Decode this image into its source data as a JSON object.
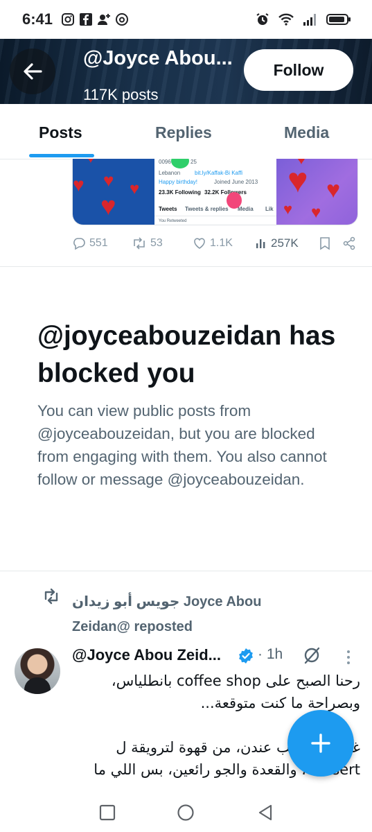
{
  "status_bar": {
    "time": "6:41",
    "left_icons": [
      "instagram-icon",
      "facebook-icon",
      "person-add-icon",
      "threads-icon"
    ],
    "right_icons": [
      "alarm-icon",
      "wifi-icon",
      "signal-icon",
      "battery-icon"
    ]
  },
  "header": {
    "display_name": "@Joyce Abou...",
    "post_count": "117K posts",
    "follow_label": "Follow"
  },
  "tabs": [
    {
      "label": "Posts",
      "active": true
    },
    {
      "label": "Replies",
      "active": false
    },
    {
      "label": "Media",
      "active": false
    }
  ],
  "media_card": {
    "phone": "0096",
    "phone_end": "25",
    "location": "Lebanon",
    "link": "bit.ly/Kaffak-Bi Kaffi",
    "birthday": "Happy birthday!",
    "joined": "Joined June 2013",
    "following": "23.3K Following",
    "followers": "32.2K Followers",
    "tab_tweets": "Tweets",
    "tab_replies": "Tweets & replies",
    "tab_media": "Media",
    "tab_likes": "Lik",
    "retweeted": "You Retweeted"
  },
  "actions": {
    "replies": "551",
    "reposts": "53",
    "likes": "1.1K",
    "views": "257K"
  },
  "blocked": {
    "title": "@joyceabouzeidan has blocked you",
    "description": "You can view public posts from @joyceabouzeidan, but you are blocked from engaging with them. You also cannot follow or message @joyceabouzeidan."
  },
  "repost": {
    "text": "جويس أبو زيدان Joyce Abou Zeidan@ reposted"
  },
  "tweet": {
    "author": "@Joyce Abou Zeid...",
    "time": "· 1h",
    "line1": "رحنا الصبح على coffee shop بانطلياس، وبصراحة ما كنت متوقعة...",
    "line2": "غير شي طيب عندن، من قهوة لترويقة ل dessert، والقعدة والجو رائعين، بس اللي ما"
  },
  "colors": {
    "accent": "#1d9bf0",
    "text_primary": "#0f1419",
    "text_secondary": "#536471"
  }
}
